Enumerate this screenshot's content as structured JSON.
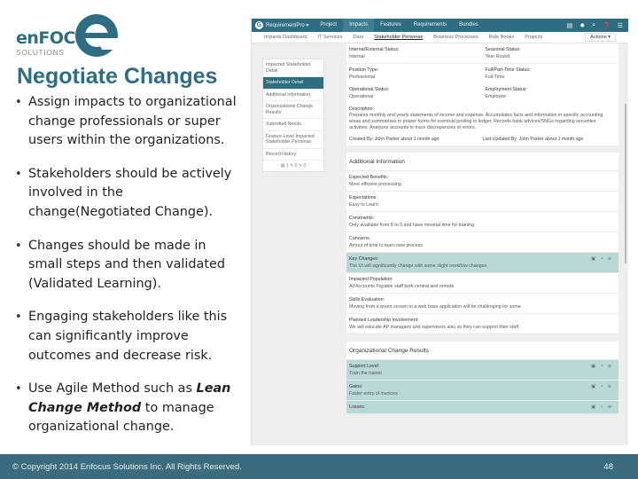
{
  "logo": {
    "name": "enFOCUS",
    "sub": "SOLUTIONS"
  },
  "slide": {
    "title": "Negotiate Changes",
    "bullets": [
      "Assign impacts to organizational change professionals or super users within the organizations.",
      "Stakeholders should be actively involved in the change(Negotiated Change).",
      "Changes should be made in small steps and then validated (Validated Learning).",
      "Engaging stakeholders like this can significantly improve outcomes and decrease risk."
    ],
    "last_bullet": {
      "pre": "Use Agile Method such as ",
      "em": "Lean Change Method",
      "post": " to manage organizational change."
    }
  },
  "app": {
    "brand": "RequirementPro ▾",
    "nav": [
      "Project",
      "Impacts",
      "Features",
      "Requirements",
      "Bundles"
    ],
    "nav_active": "Impacts",
    "nav_icons": [
      "document-icon",
      "gear-icon",
      "search-icon",
      "help-icon",
      "menu-icon"
    ],
    "subnav": [
      "Impacts Dashboard",
      "IT Services",
      "Data",
      "Stakeholder Personas",
      "Business Processes",
      "Rule Books",
      "Projects"
    ],
    "subnav_active": "Stakeholder Personas",
    "actions_label": "Actions ▾",
    "sidebar": [
      "Impacted Stakeholder Detail",
      "Stakeholder Detail",
      "Additional Information",
      "Organizational Change Results",
      "Submitted Needs",
      "Feature-Level Impacted Stakeholder Personas",
      "Record History"
    ],
    "sidebar_active": "Stakeholder Detail",
    "sidebar_counts": "▤ 1   ✎ 0   ✎ 0",
    "detail": [
      [
        {
          "label": "Internal/External Status:",
          "value": "Internal"
        },
        {
          "label": "Seasonal Status:",
          "value": "Year Round"
        }
      ],
      [
        {
          "label": "Position Type:",
          "value": "Professional"
        },
        {
          "label": "Full/Part-Time Status:",
          "value": "Full-Time"
        }
      ],
      [
        {
          "label": "Operational Status:",
          "value": "Operational"
        },
        {
          "label": "Employment Status:",
          "value": "Employee"
        }
      ]
    ],
    "description_label": "Description:",
    "description": "Prepares monthly and yearly statements of income and expense. Accumulates facts and information in specific accounting areas and summarizes in proper forms for eventual posting to ledger. Records bank advices/SNGs regarding securities activities. Analyzes accounts to trace discrepancies or errors.",
    "created_by": "Created By: John Parker about 1 month ago",
    "updated_by": "Last Updated By: John Parker about 1 month ago",
    "additional": {
      "title": "Additional Information",
      "fields": [
        {
          "label": "Expected Benefits:",
          "value": "More efficient processing",
          "highlight": false
        },
        {
          "label": "Expectations:",
          "value": "Easy to Learn",
          "highlight": false
        },
        {
          "label": "Constraints:",
          "value": "Only available from 8 to 5 and have minimal time for training.",
          "highlight": false
        },
        {
          "label": "Concerns:",
          "value": "Amout of time to learn new process",
          "highlight": false
        },
        {
          "label": "Key Changes:",
          "value": "The UI will significantly change with some slight workflow changes",
          "highlight": true
        },
        {
          "label": "Impacted Population:",
          "value": "All Accounts Payable staff both central and remote",
          "highlight": false
        },
        {
          "label": "Skills Evaluation:",
          "value": "Moving from a green screen to a web base application will be challenging for some.",
          "highlight": false
        },
        {
          "label": "Planned Leadership Involvement:",
          "value": "We will educate AP managers and supervisors also so they can support thier staff.",
          "highlight": false
        }
      ]
    },
    "org_results": {
      "title": "Organizational Change Results",
      "fields": [
        {
          "label": "Support Level:",
          "value": "Train the trainer",
          "highlight": true
        },
        {
          "label": "Gains:",
          "value": "Faster entry of invoices",
          "highlight": true
        },
        {
          "label": "Losses:",
          "value": "",
          "highlight": true
        }
      ]
    },
    "row_tools": "▣ ◔ ⊖"
  },
  "footer": {
    "copyright": "© Copyright 2014 Enfocus Solutions Inc. All Rights Reserved.",
    "page_number": "48"
  },
  "colors": {
    "brand": "#2f6e82",
    "highlight_row": "#b9d9d4",
    "footer": "#3a6c7d"
  }
}
